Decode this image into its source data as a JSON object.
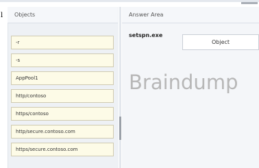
{
  "stray_char": "l",
  "objects_panel": {
    "title": "Objects",
    "items": [
      "-r",
      "-s",
      "AppPool1",
      "http/contoso",
      "https/contoso",
      "http/secure.contoso.com",
      "https/secure.contoso.com"
    ]
  },
  "answer_area": {
    "title": "Answer Area",
    "command": "setspn.exe",
    "target_placeholder": "Object",
    "watermark": "Braindump"
  }
}
